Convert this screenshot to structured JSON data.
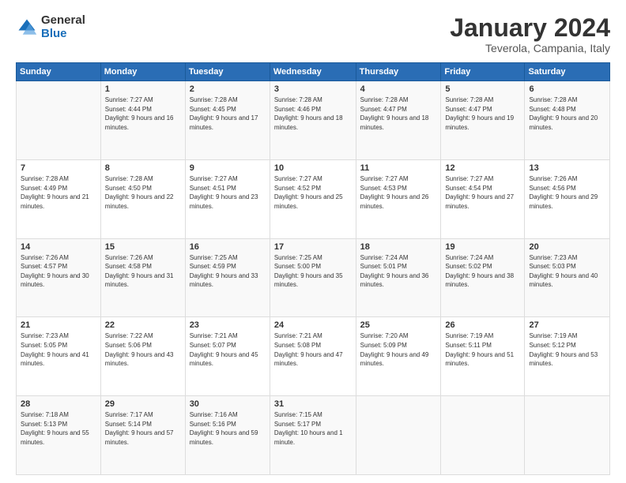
{
  "logo": {
    "general": "General",
    "blue": "Blue"
  },
  "header": {
    "month": "January 2024",
    "location": "Teverola, Campania, Italy"
  },
  "days_of_week": [
    "Sunday",
    "Monday",
    "Tuesday",
    "Wednesday",
    "Thursday",
    "Friday",
    "Saturday"
  ],
  "weeks": [
    [
      {
        "day": "",
        "sunrise": "",
        "sunset": "",
        "daylight": ""
      },
      {
        "day": "1",
        "sunrise": "Sunrise: 7:27 AM",
        "sunset": "Sunset: 4:44 PM",
        "daylight": "Daylight: 9 hours and 16 minutes."
      },
      {
        "day": "2",
        "sunrise": "Sunrise: 7:28 AM",
        "sunset": "Sunset: 4:45 PM",
        "daylight": "Daylight: 9 hours and 17 minutes."
      },
      {
        "day": "3",
        "sunrise": "Sunrise: 7:28 AM",
        "sunset": "Sunset: 4:46 PM",
        "daylight": "Daylight: 9 hours and 18 minutes."
      },
      {
        "day": "4",
        "sunrise": "Sunrise: 7:28 AM",
        "sunset": "Sunset: 4:47 PM",
        "daylight": "Daylight: 9 hours and 18 minutes."
      },
      {
        "day": "5",
        "sunrise": "Sunrise: 7:28 AM",
        "sunset": "Sunset: 4:47 PM",
        "daylight": "Daylight: 9 hours and 19 minutes."
      },
      {
        "day": "6",
        "sunrise": "Sunrise: 7:28 AM",
        "sunset": "Sunset: 4:48 PM",
        "daylight": "Daylight: 9 hours and 20 minutes."
      }
    ],
    [
      {
        "day": "7",
        "sunrise": "Sunrise: 7:28 AM",
        "sunset": "Sunset: 4:49 PM",
        "daylight": "Daylight: 9 hours and 21 minutes."
      },
      {
        "day": "8",
        "sunrise": "Sunrise: 7:28 AM",
        "sunset": "Sunset: 4:50 PM",
        "daylight": "Daylight: 9 hours and 22 minutes."
      },
      {
        "day": "9",
        "sunrise": "Sunrise: 7:27 AM",
        "sunset": "Sunset: 4:51 PM",
        "daylight": "Daylight: 9 hours and 23 minutes."
      },
      {
        "day": "10",
        "sunrise": "Sunrise: 7:27 AM",
        "sunset": "Sunset: 4:52 PM",
        "daylight": "Daylight: 9 hours and 25 minutes."
      },
      {
        "day": "11",
        "sunrise": "Sunrise: 7:27 AM",
        "sunset": "Sunset: 4:53 PM",
        "daylight": "Daylight: 9 hours and 26 minutes."
      },
      {
        "day": "12",
        "sunrise": "Sunrise: 7:27 AM",
        "sunset": "Sunset: 4:54 PM",
        "daylight": "Daylight: 9 hours and 27 minutes."
      },
      {
        "day": "13",
        "sunrise": "Sunrise: 7:26 AM",
        "sunset": "Sunset: 4:56 PM",
        "daylight": "Daylight: 9 hours and 29 minutes."
      }
    ],
    [
      {
        "day": "14",
        "sunrise": "Sunrise: 7:26 AM",
        "sunset": "Sunset: 4:57 PM",
        "daylight": "Daylight: 9 hours and 30 minutes."
      },
      {
        "day": "15",
        "sunrise": "Sunrise: 7:26 AM",
        "sunset": "Sunset: 4:58 PM",
        "daylight": "Daylight: 9 hours and 31 minutes."
      },
      {
        "day": "16",
        "sunrise": "Sunrise: 7:25 AM",
        "sunset": "Sunset: 4:59 PM",
        "daylight": "Daylight: 9 hours and 33 minutes."
      },
      {
        "day": "17",
        "sunrise": "Sunrise: 7:25 AM",
        "sunset": "Sunset: 5:00 PM",
        "daylight": "Daylight: 9 hours and 35 minutes."
      },
      {
        "day": "18",
        "sunrise": "Sunrise: 7:24 AM",
        "sunset": "Sunset: 5:01 PM",
        "daylight": "Daylight: 9 hours and 36 minutes."
      },
      {
        "day": "19",
        "sunrise": "Sunrise: 7:24 AM",
        "sunset": "Sunset: 5:02 PM",
        "daylight": "Daylight: 9 hours and 38 minutes."
      },
      {
        "day": "20",
        "sunrise": "Sunrise: 7:23 AM",
        "sunset": "Sunset: 5:03 PM",
        "daylight": "Daylight: 9 hours and 40 minutes."
      }
    ],
    [
      {
        "day": "21",
        "sunrise": "Sunrise: 7:23 AM",
        "sunset": "Sunset: 5:05 PM",
        "daylight": "Daylight: 9 hours and 41 minutes."
      },
      {
        "day": "22",
        "sunrise": "Sunrise: 7:22 AM",
        "sunset": "Sunset: 5:06 PM",
        "daylight": "Daylight: 9 hours and 43 minutes."
      },
      {
        "day": "23",
        "sunrise": "Sunrise: 7:21 AM",
        "sunset": "Sunset: 5:07 PM",
        "daylight": "Daylight: 9 hours and 45 minutes."
      },
      {
        "day": "24",
        "sunrise": "Sunrise: 7:21 AM",
        "sunset": "Sunset: 5:08 PM",
        "daylight": "Daylight: 9 hours and 47 minutes."
      },
      {
        "day": "25",
        "sunrise": "Sunrise: 7:20 AM",
        "sunset": "Sunset: 5:09 PM",
        "daylight": "Daylight: 9 hours and 49 minutes."
      },
      {
        "day": "26",
        "sunrise": "Sunrise: 7:19 AM",
        "sunset": "Sunset: 5:11 PM",
        "daylight": "Daylight: 9 hours and 51 minutes."
      },
      {
        "day": "27",
        "sunrise": "Sunrise: 7:19 AM",
        "sunset": "Sunset: 5:12 PM",
        "daylight": "Daylight: 9 hours and 53 minutes."
      }
    ],
    [
      {
        "day": "28",
        "sunrise": "Sunrise: 7:18 AM",
        "sunset": "Sunset: 5:13 PM",
        "daylight": "Daylight: 9 hours and 55 minutes."
      },
      {
        "day": "29",
        "sunrise": "Sunrise: 7:17 AM",
        "sunset": "Sunset: 5:14 PM",
        "daylight": "Daylight: 9 hours and 57 minutes."
      },
      {
        "day": "30",
        "sunrise": "Sunrise: 7:16 AM",
        "sunset": "Sunset: 5:16 PM",
        "daylight": "Daylight: 9 hours and 59 minutes."
      },
      {
        "day": "31",
        "sunrise": "Sunrise: 7:15 AM",
        "sunset": "Sunset: 5:17 PM",
        "daylight": "Daylight: 10 hours and 1 minute."
      },
      {
        "day": "",
        "sunrise": "",
        "sunset": "",
        "daylight": ""
      },
      {
        "day": "",
        "sunrise": "",
        "sunset": "",
        "daylight": ""
      },
      {
        "day": "",
        "sunrise": "",
        "sunset": "",
        "daylight": ""
      }
    ]
  ]
}
